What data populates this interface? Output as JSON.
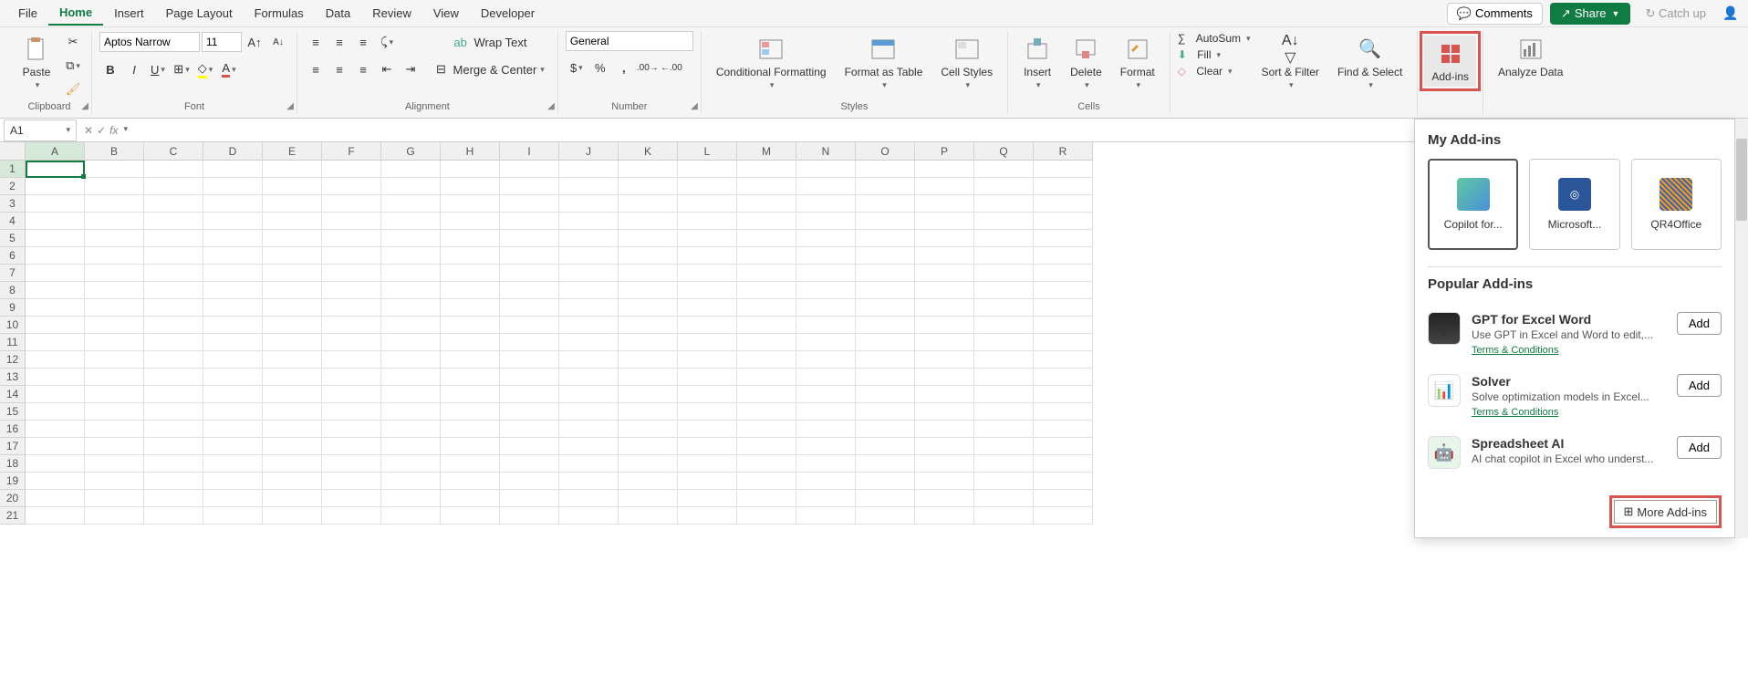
{
  "tabs": {
    "file": "File",
    "home": "Home",
    "insert": "Insert",
    "page_layout": "Page Layout",
    "formulas": "Formulas",
    "data": "Data",
    "review": "Review",
    "view": "View",
    "developer": "Developer"
  },
  "header": {
    "comments": "Comments",
    "share": "Share",
    "catchup": "Catch up"
  },
  "ribbon": {
    "clipboard": {
      "paste": "Paste",
      "label": "Clipboard"
    },
    "font": {
      "name": "Aptos Narrow",
      "size": "11",
      "label": "Font"
    },
    "alignment": {
      "wrap": "Wrap Text",
      "merge": "Merge & Center",
      "label": "Alignment"
    },
    "number": {
      "format": "General",
      "label": "Number"
    },
    "styles": {
      "cond": "Conditional Formatting",
      "table": "Format as Table",
      "cell": "Cell Styles",
      "label": "Styles"
    },
    "cells": {
      "insert": "Insert",
      "delete": "Delete",
      "format": "Format",
      "label": "Cells"
    },
    "editing": {
      "autosum": "AutoSum",
      "fill": "Fill",
      "clear": "Clear",
      "sort": "Sort & Filter",
      "find": "Find & Select"
    },
    "addins": {
      "label": "Add-ins"
    },
    "analyze": {
      "label": "Analyze Data"
    }
  },
  "formula_bar": {
    "cell": "A1"
  },
  "columns": [
    "A",
    "B",
    "C",
    "D",
    "E",
    "F",
    "G",
    "H",
    "I",
    "J",
    "K",
    "L",
    "M",
    "N",
    "O",
    "P",
    "Q",
    "R"
  ],
  "rows": [
    "1",
    "2",
    "3",
    "4",
    "5",
    "6",
    "7",
    "8",
    "9",
    "10",
    "11",
    "12",
    "13",
    "14",
    "15",
    "16",
    "17",
    "18",
    "19",
    "20",
    "21"
  ],
  "pane": {
    "my_title": "My Add-ins",
    "my": [
      {
        "label": "Copilot for..."
      },
      {
        "label": "Microsoft..."
      },
      {
        "label": "QR4Office"
      }
    ],
    "popular_title": "Popular Add-ins",
    "popular": [
      {
        "title": "GPT for Excel Word",
        "desc": "Use GPT in Excel and Word to edit,...",
        "terms": "Terms & Conditions",
        "btn": "Add"
      },
      {
        "title": "Solver",
        "desc": "Solve optimization models in Excel...",
        "terms": "Terms & Conditions",
        "btn": "Add"
      },
      {
        "title": "Spreadsheet AI",
        "desc": "AI chat copilot in Excel who underst...",
        "terms": "",
        "btn": "Add"
      }
    ],
    "more": "More Add-ins"
  }
}
